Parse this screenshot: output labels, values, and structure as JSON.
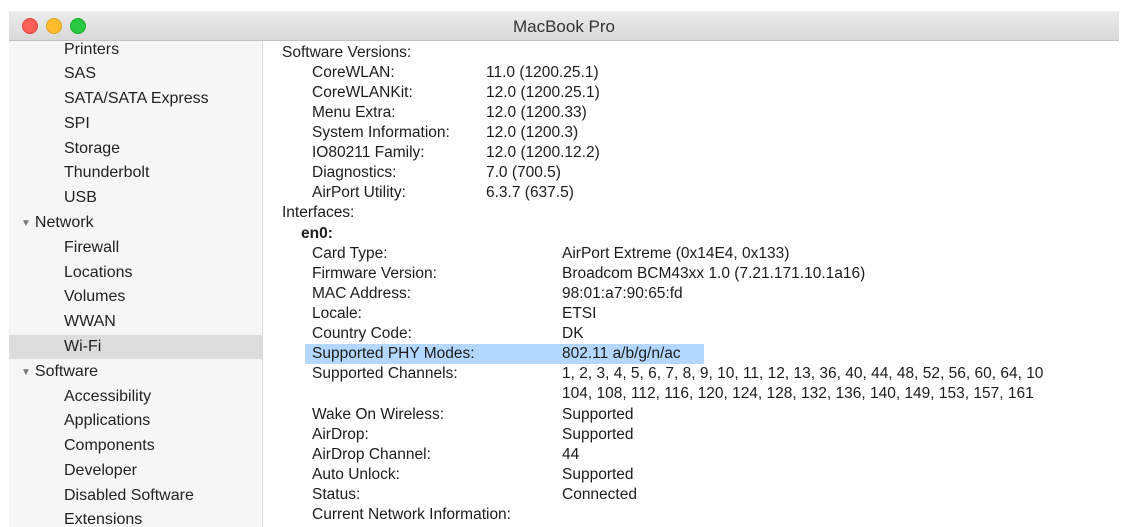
{
  "window": {
    "title": "MacBook Pro"
  },
  "sidebar": {
    "items": [
      {
        "label": "Printers",
        "group": false,
        "selected": false
      },
      {
        "label": "SAS",
        "group": false,
        "selected": false
      },
      {
        "label": "SATA/SATA Express",
        "group": false,
        "selected": false
      },
      {
        "label": "SPI",
        "group": false,
        "selected": false
      },
      {
        "label": "Storage",
        "group": false,
        "selected": false
      },
      {
        "label": "Thunderbolt",
        "group": false,
        "selected": false
      },
      {
        "label": "USB",
        "group": false,
        "selected": false
      },
      {
        "label": "Network",
        "group": true,
        "selected": false
      },
      {
        "label": "Firewall",
        "group": false,
        "selected": false
      },
      {
        "label": "Locations",
        "group": false,
        "selected": false
      },
      {
        "label": "Volumes",
        "group": false,
        "selected": false
      },
      {
        "label": "WWAN",
        "group": false,
        "selected": false
      },
      {
        "label": "Wi-Fi",
        "group": false,
        "selected": true
      },
      {
        "label": "Software",
        "group": true,
        "selected": false
      },
      {
        "label": "Accessibility",
        "group": false,
        "selected": false
      },
      {
        "label": "Applications",
        "group": false,
        "selected": false
      },
      {
        "label": "Components",
        "group": false,
        "selected": false
      },
      {
        "label": "Developer",
        "group": false,
        "selected": false
      },
      {
        "label": "Disabled Software",
        "group": false,
        "selected": false
      },
      {
        "label": "Extensions",
        "group": false,
        "selected": false
      }
    ]
  },
  "details": {
    "software_versions": {
      "heading": "Software Versions:",
      "rows": [
        {
          "key": "CoreWLAN:",
          "value": "11.0 (1200.25.1)"
        },
        {
          "key": "CoreWLANKit:",
          "value": "12.0 (1200.25.1)"
        },
        {
          "key": "Menu Extra:",
          "value": "12.0 (1200.33)"
        },
        {
          "key": "System Information:",
          "value": "12.0 (1200.3)"
        },
        {
          "key": "IO80211 Family:",
          "value": "12.0 (1200.12.2)"
        },
        {
          "key": "Diagnostics:",
          "value": "7.0 (700.5)"
        },
        {
          "key": "AirPort Utility:",
          "value": "6.3.7 (637.5)"
        }
      ]
    },
    "interfaces": {
      "heading": "Interfaces:",
      "name": "en0:",
      "rows": [
        {
          "key": "Card Type:",
          "value": "AirPort Extreme  (0x14E4, 0x133)"
        },
        {
          "key": "Firmware Version:",
          "value": "Broadcom BCM43xx 1.0 (7.21.171.10.1a16)"
        },
        {
          "key": "MAC Address:",
          "value": "98:01:a7:90:65:fd"
        },
        {
          "key": "Locale:",
          "value": "ETSI"
        },
        {
          "key": "Country Code:",
          "value": "DK"
        },
        {
          "key": "Supported PHY Modes:",
          "value": "802.11 a/b/g/n/ac",
          "highlighted": true
        },
        {
          "key": "Supported Channels:",
          "value": "1, 2, 3, 4, 5, 6, 7, 8, 9, 10, 11, 12, 13, 36, 40, 44, 48, 52, 56, 60, 64, 10",
          "value2": "104, 108, 112, 116, 120, 124, 128, 132, 136, 140, 149, 153, 157, 161"
        },
        {
          "key": "Wake On Wireless:",
          "value": "Supported"
        },
        {
          "key": "AirDrop:",
          "value": "Supported"
        },
        {
          "key": "AirDrop Channel:",
          "value": "44"
        },
        {
          "key": "Auto Unlock:",
          "value": "Supported"
        },
        {
          "key": "Status:",
          "value": "Connected"
        },
        {
          "key": "Current Network Information:",
          "value": ""
        }
      ]
    }
  }
}
